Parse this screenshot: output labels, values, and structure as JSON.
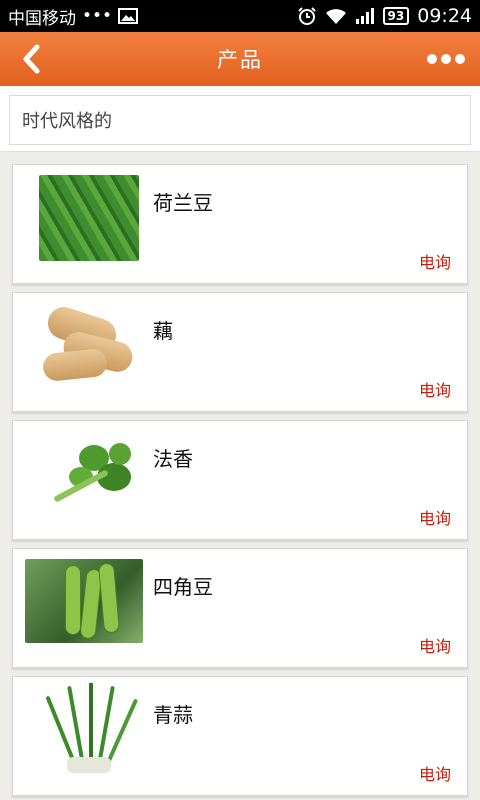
{
  "status_bar": {
    "carrier": "中国移动",
    "dots": "•••",
    "battery": "93",
    "time": "09:24"
  },
  "header": {
    "title": "产品"
  },
  "search": {
    "text": "时代风格的"
  },
  "products": [
    {
      "name": "荷兰豆",
      "action": "电询",
      "thumb_icon": "snow-peas-image"
    },
    {
      "name": "藕",
      "action": "电询",
      "thumb_icon": "lotus-root-image"
    },
    {
      "name": "法香",
      "action": "电询",
      "thumb_icon": "parsley-image"
    },
    {
      "name": "四角豆",
      "action": "电询",
      "thumb_icon": "winged-bean-image"
    },
    {
      "name": "青蒜",
      "action": "电询",
      "thumb_icon": "green-garlic-image"
    }
  ],
  "colors": {
    "header_top": "#f2803f",
    "header_bottom": "#e2601f",
    "inquiry": "#c2200c",
    "background": "#eeede9"
  }
}
